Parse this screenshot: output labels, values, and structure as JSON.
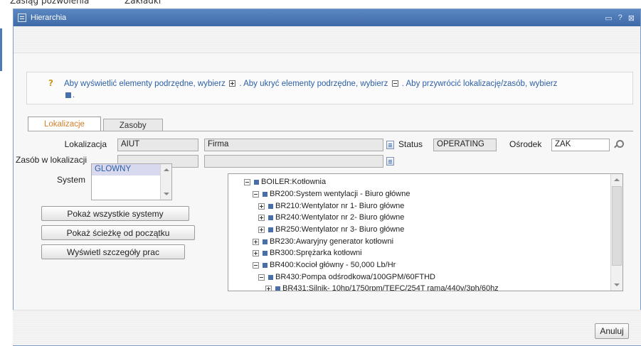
{
  "background": {
    "text1": "Zasiąg pozwolenia",
    "text2": "Zakładki"
  },
  "dialog": {
    "title": "Hierarchia",
    "title_buttons": [
      "▭",
      "?",
      "⊠"
    ]
  },
  "info": {
    "text_part1": "Aby wyświetlić elementy podrzędne, wybierz",
    "text_part2": ". Aby ukryć elementy podrzędne, wybierz",
    "text_part3": ". Aby przywrócić lokalizację/zasób, wybierz",
    "text_part4": "."
  },
  "tabs": [
    {
      "label": "Lokalizacje",
      "active": true
    },
    {
      "label": "Zasoby",
      "active": false
    }
  ],
  "form": {
    "lokalizacja_label": "Lokalizacja",
    "lokalizacja_value": "AIUT",
    "lokalizacja_desc": "Firma",
    "status_label": "Status",
    "status_value": "OPERATING",
    "osrodek_label": "Ośrodek",
    "osrodek_value": "ZAK",
    "zasob_label": "Zasób w lokalizacji",
    "zasob_value": "",
    "zasob_desc": "",
    "system_label": "System",
    "system_selected": "GLOWNY"
  },
  "buttons": {
    "show_all_systems": "Pokaż wszystkie systemy",
    "show_path": "Pokaż ścieżkę od początku",
    "show_work_details": "Wyświetl szczegóły prac",
    "cancel": "Anuluj"
  },
  "tree": [
    {
      "label": "BOILER:Kotłownia",
      "toggle": "minus"
    },
    {
      "label": "BR200:System wentylacji - Biuro główne",
      "toggle": "minus"
    },
    {
      "label": "BR210:Wentylator nr 1- Biuro główne",
      "toggle": "plus"
    },
    {
      "label": "BR240:Wentylator nr 2- Biuro główne",
      "toggle": "plus"
    },
    {
      "label": "BR250:Wentylator nr 3- Biuro główne",
      "toggle": "plus"
    },
    {
      "label": "BR230:Awaryjny generator kotłowni",
      "toggle": "plus"
    },
    {
      "label": "BR300:Sprężarka kotłowni",
      "toggle": "plus"
    },
    {
      "label": "BR400:Kocioł główny - 50,000 Lb/Hr",
      "toggle": "minus"
    },
    {
      "label": "BR430:Pompa odśrodkowa/100GPM/60FTHD",
      "toggle": "minus"
    },
    {
      "label": "BR431:Silnik- 10hp/1750rpm/TEFC/254T rama/440v/3ph/60hz",
      "toggle": "plus"
    }
  ]
}
